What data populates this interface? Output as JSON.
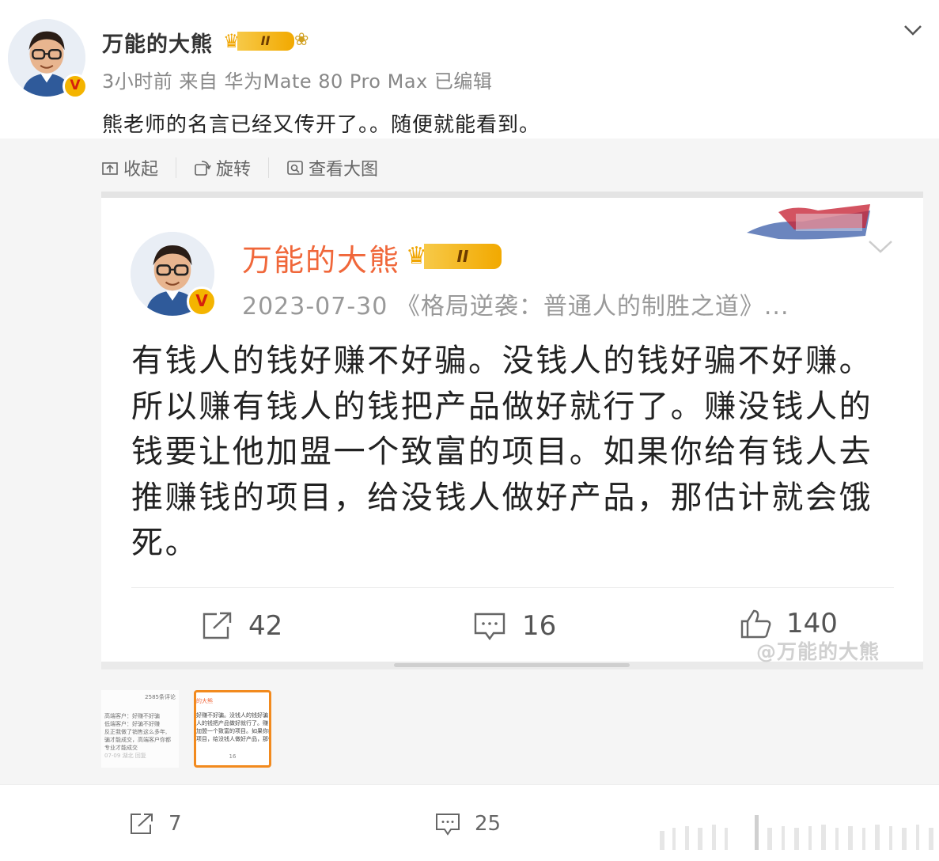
{
  "post": {
    "author": "万能的大熊",
    "badge_level": "II",
    "meta": "3小时前 来自 华为Mate 80 Pro Max 已编辑",
    "text": "熊老师的名言已经又传开了。。随便就能看到。"
  },
  "image_toolbar": {
    "collapse": "收起",
    "rotate": "旋转",
    "view_large": "查看大图"
  },
  "embedded_post": {
    "author": "万能的大熊",
    "badge_level": "II",
    "meta": "2023-07-30 《格局逆袭：普通人的制胜之道》...",
    "lines": [
      "有钱人的钱好赚不好骗。没钱人的钱好骗不好赚。",
      "所以赚有钱人的钱把产品做好就行了。赚没钱人的",
      "钱要让他加盟一个致富的项目。如果你给有钱人去",
      "推赚钱的项目，给没钱人做好产品，那估计就会饿",
      "死。"
    ],
    "share_count": "42",
    "comment_count": "16",
    "like_count": "140",
    "watermark": "@万能的大熊"
  },
  "thumbnails": {
    "first": {
      "header": "2585条评论",
      "lines": [
        "高端客户：好赚不好骗",
        "低端客户：好骗不好赚",
        "反正我做了销售这么多年,",
        "骗才能成交，高端客户你都",
        "专业才能成交"
      ],
      "footer": "07-09  湖北  回复"
    },
    "second": {
      "header": "的大熊",
      "lines": [
        "好赚不好骗。没钱人的钱好骗",
        "人的钱把产品做好就行了。赚",
        "加盟一个致富的项目。如果你给",
        "项目，给没钱人做好产品，那估"
      ],
      "footer": "16"
    }
  },
  "actions": {
    "share_count": "7",
    "comment_count": "25"
  },
  "colors": {
    "inner_name": "#f0673a",
    "badge_gold": "#f2a900",
    "thumb_selected": "#f28a1e"
  }
}
